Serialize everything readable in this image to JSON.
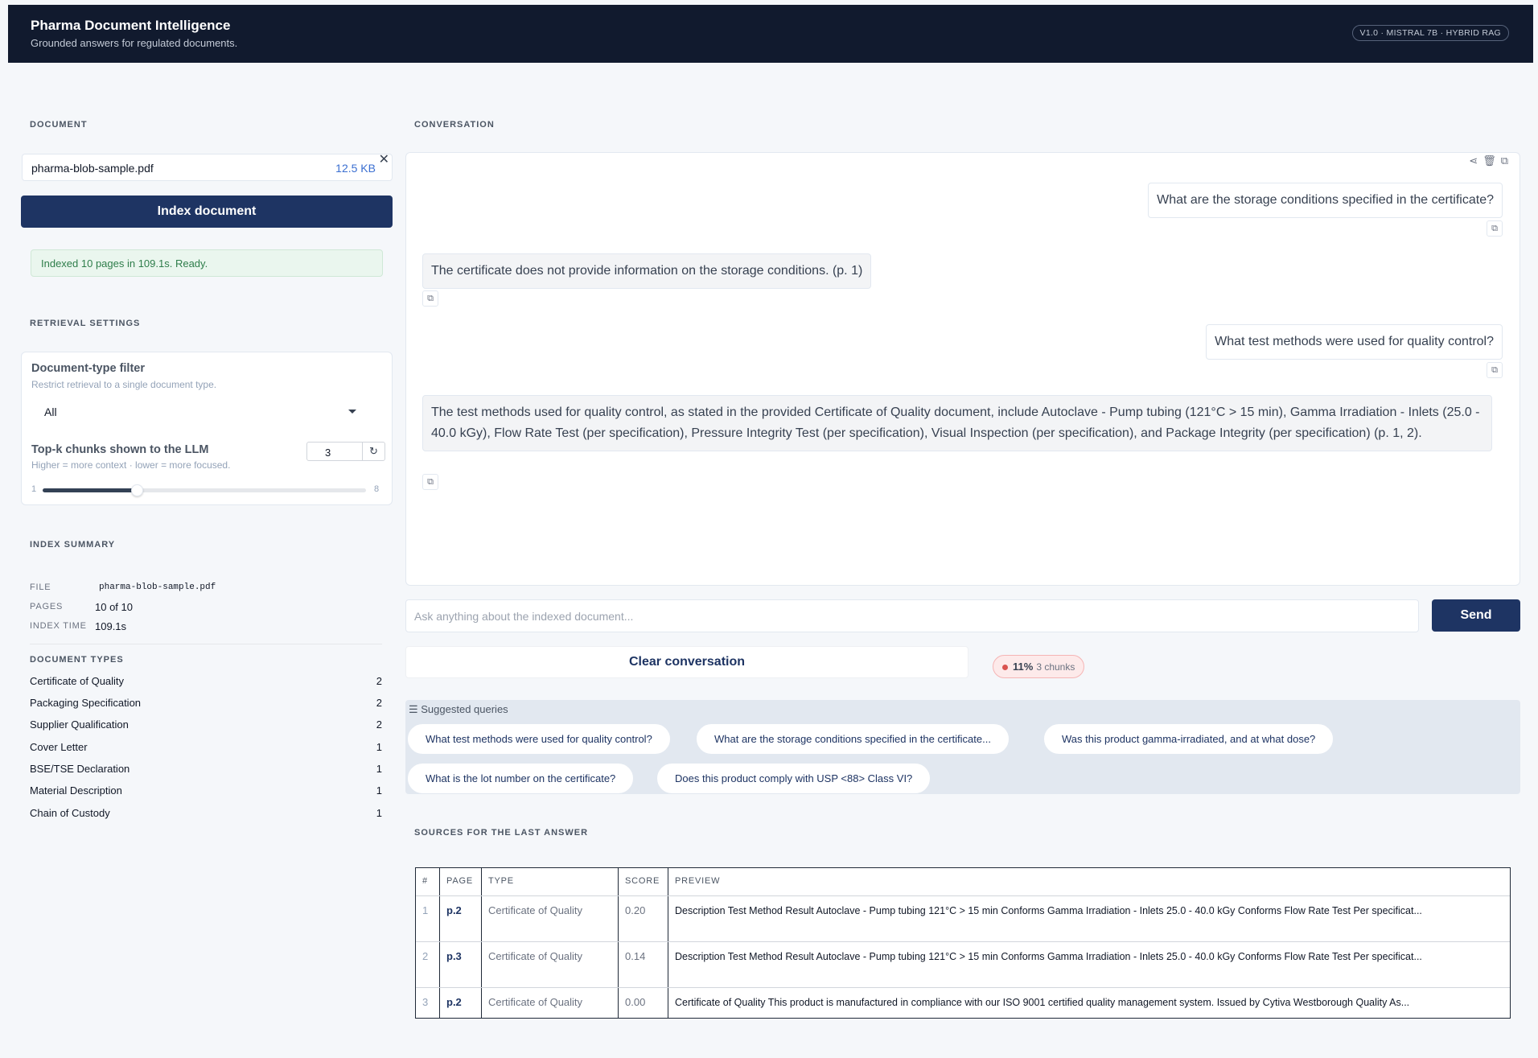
{
  "header": {
    "title": "Pharma Document Intelligence",
    "subtitle": "Grounded answers for regulated documents.",
    "badge": "V1.0 · MISTRAL 7B · HYBRID RAG"
  },
  "sidebar": {
    "document_label": "DOCUMENT",
    "file_name": "pharma-blob-sample.pdf",
    "file_size": "12.5 KB",
    "index_button": "Index document",
    "status": "Indexed 10 pages in 109.1s. Ready.",
    "retrieval_label": "RETRIEVAL SETTINGS",
    "doc_filter_label": "Document-type filter",
    "doc_filter_help": "Restrict retrieval to a single document type.",
    "doc_filter_value": "All",
    "topk_label": "Top-k chunks shown to the LLM",
    "topk_help": "Higher = more context · lower = more focused.",
    "topk_value": "3",
    "slider_min": "1",
    "slider_max": "8",
    "slider_level": 0.29,
    "summary_label": "INDEX SUMMARY",
    "summary": {
      "file_key": "FILE",
      "file_val": "pharma-blob-sample.pdf",
      "pages_key": "PAGES",
      "pages_val": "10 of 10",
      "time_key": "INDEX TIME",
      "time_val": "109.1s"
    },
    "doc_types_label": "DOCUMENT TYPES",
    "doc_types": [
      {
        "name": "Certificate of Quality",
        "count": "2"
      },
      {
        "name": "Packaging Specification",
        "count": "2"
      },
      {
        "name": "Supplier Qualification",
        "count": "2"
      },
      {
        "name": "Cover Letter",
        "count": "1"
      },
      {
        "name": "BSE/TSE Declaration",
        "count": "1"
      },
      {
        "name": "Material Description",
        "count": "1"
      },
      {
        "name": "Chain of Custody",
        "count": "1"
      }
    ]
  },
  "conversation": {
    "label": "CONVERSATION",
    "messages": [
      {
        "role": "user",
        "text": "What are the storage conditions specified in the certificate?"
      },
      {
        "role": "assistant",
        "text": "The certificate does not provide information on the storage conditions. (p. 1)"
      },
      {
        "role": "user",
        "text": "What test methods were used for quality control?"
      },
      {
        "role": "assistant",
        "text": "The test methods used for quality control, as stated in the provided Certificate of Quality document, include Autoclave - Pump tubing (121°C > 15 min), Gamma Irradiation - Inlets (25.0 - 40.0 kGy), Flow Rate Test (per specification), Pressure Integrity Test (per specification), Visual Inspection (per specification), and Package Integrity (per specification) (p. 1, 2)."
      }
    ],
    "input_placeholder": "Ask anything about the indexed document...",
    "send_label": "Send",
    "clear_label": "Clear conversation",
    "confidence": "11%",
    "chunks": "3 chunks"
  },
  "suggested": {
    "label": "☰ Suggested queries",
    "items": [
      "What test methods were used for quality control?",
      "What are the storage conditions specified in the certificate...",
      "Was this product gamma-irradiated, and at what dose?",
      "What is the lot number on the certificate?",
      "Does this product comply with USP <88> Class VI?"
    ]
  },
  "sources": {
    "label": "SOURCES FOR THE LAST ANSWER",
    "headers": [
      "#",
      "PAGE",
      "TYPE",
      "SCORE",
      "PREVIEW"
    ],
    "rows": [
      {
        "n": "1",
        "page": "p.2",
        "type": "Certificate of Quality",
        "score": "0.20",
        "preview": "Description Test Method Result Autoclave - Pump tubing 121°C > 15 min Conforms Gamma Irradiation - Inlets 25.0 - 40.0 kGy Conforms Flow Rate Test Per specificat..."
      },
      {
        "n": "2",
        "page": "p.3",
        "type": "Certificate of Quality",
        "score": "0.14",
        "preview": "Description Test Method Result Autoclave - Pump tubing 121°C > 15 min Conforms Gamma Irradiation - Inlets 25.0 - 40.0 kGy Conforms Flow Rate Test Per specificat..."
      },
      {
        "n": "3",
        "page": "p.2",
        "type": "Certificate of Quality",
        "score": "0.00",
        "preview": "Certificate of Quality This product is manufactured in compliance with our ISO 9001 certified quality management system. Issued by Cytiva Westborough Quality As..."
      }
    ]
  }
}
